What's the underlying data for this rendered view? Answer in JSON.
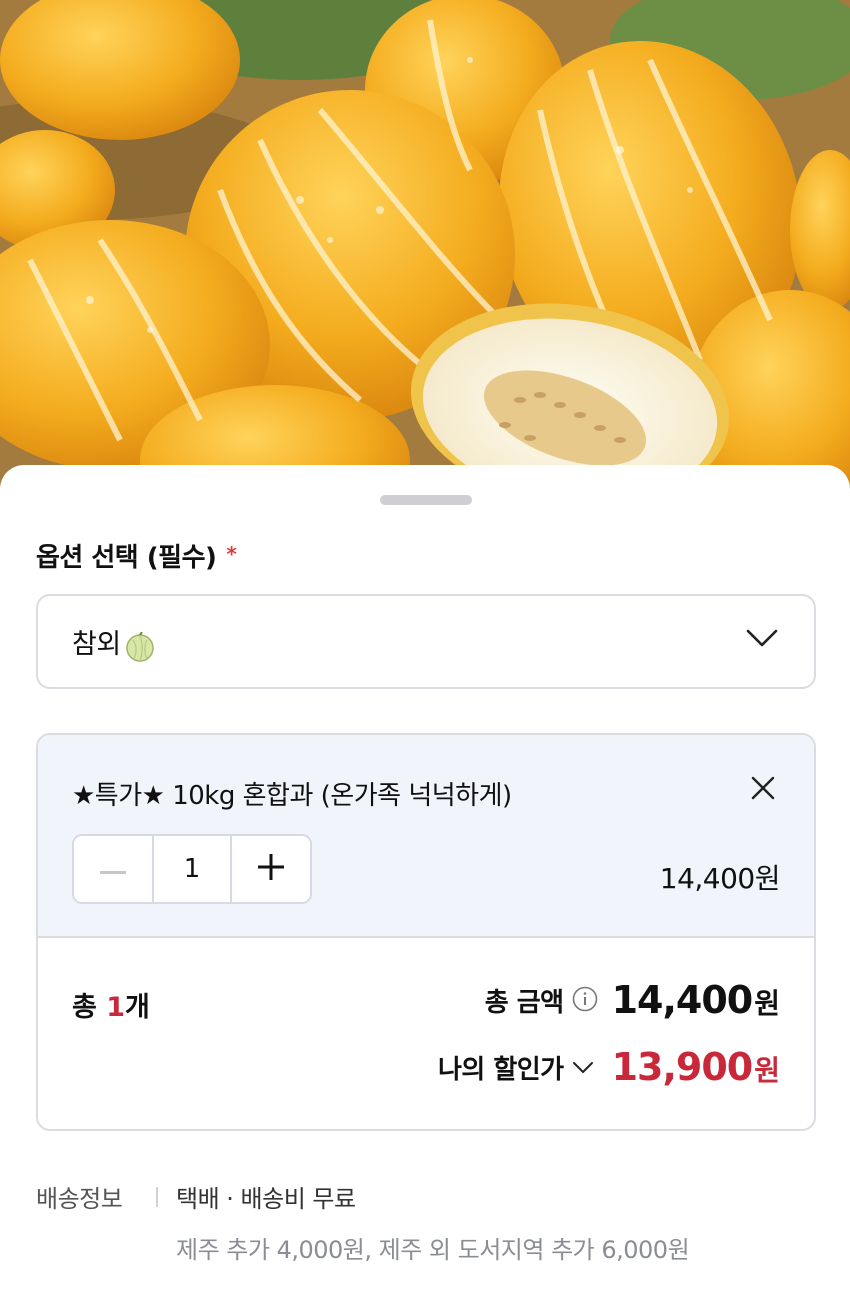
{
  "option": {
    "title": "옵션 선택 (필수)",
    "required_mark": "*",
    "selected_value": "참외",
    "icons": {
      "product": "melon-icon",
      "dropdown": "chevron-down-icon"
    }
  },
  "item": {
    "name": "★특가★ 10kg 혼합과 (온가족 넉넉하게)",
    "quantity": "1",
    "price": "14,400원",
    "icons": {
      "remove": "close-icon",
      "decrement": "minus-icon",
      "increment": "plus-icon"
    }
  },
  "summary": {
    "count_prefix": "총 ",
    "count_value": "1",
    "count_suffix": "개",
    "total_label": "총 금액",
    "total_amount": "14,400",
    "total_unit": "원",
    "discount_label": "나의 할인가",
    "discount_amount": "13,900",
    "discount_unit": "원"
  },
  "shipping": {
    "label": "배송정보",
    "value": "택배 · 배송비 무료",
    "extra": "제주 추가 4,000원, 제주 외 도서지역 추가 6,000원"
  },
  "colors": {
    "accent": "#c8283a",
    "required": "#e23b3b",
    "card_top_bg": "#f1f4fa",
    "border": "#dadce1"
  }
}
